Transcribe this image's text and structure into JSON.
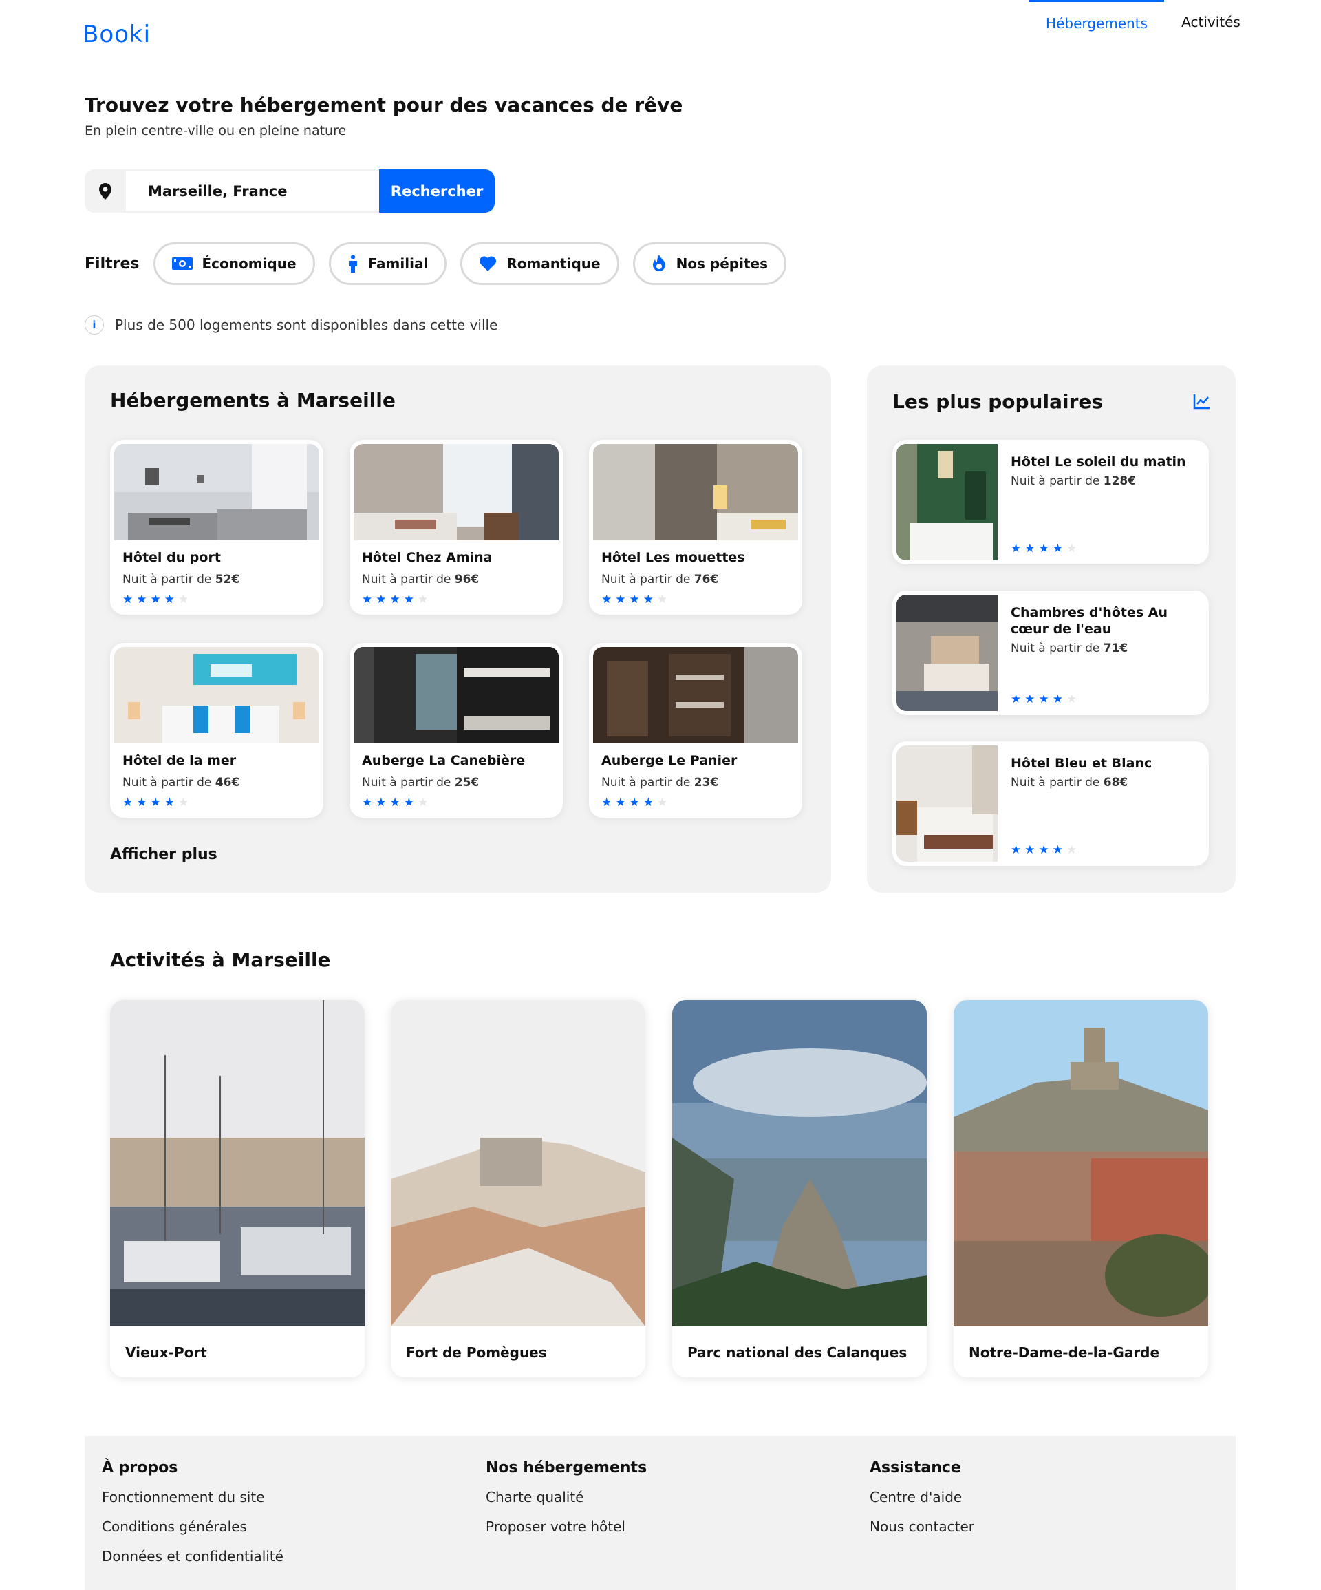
{
  "header": {
    "logo": "Booki",
    "nav": [
      {
        "label": "Hébergements",
        "active": true
      },
      {
        "label": "Activités",
        "active": false
      }
    ]
  },
  "hero": {
    "title": "Trouvez votre hébergement pour des vacances de rêve",
    "subtitle": "En plein centre-ville ou en pleine nature"
  },
  "search": {
    "value": "Marseille, France",
    "button": "Rechercher",
    "icon": "location-pin-icon"
  },
  "filters": {
    "label": "Filtres",
    "items": [
      {
        "label": "Économique",
        "icon": "money-icon"
      },
      {
        "label": "Familial",
        "icon": "person-icon"
      },
      {
        "label": "Romantique",
        "icon": "heart-icon"
      },
      {
        "label": "Nos pépites",
        "icon": "fire-icon"
      }
    ]
  },
  "info": {
    "text": "Plus de 500 logements sont disponibles dans cette ville"
  },
  "accommodations": {
    "title": "Hébergements à Marseille",
    "price_prefix": "Nuit à partir de ",
    "items": [
      {
        "name": "Hôtel du port",
        "price": "52€",
        "rating": 4
      },
      {
        "name": "Hôtel Chez Amina",
        "price": "96€",
        "rating": 4
      },
      {
        "name": "Hôtel Les mouettes",
        "price": "76€",
        "rating": 4
      },
      {
        "name": "Hôtel de la mer",
        "price": "46€",
        "rating": 4
      },
      {
        "name": "Auberge La Canebière",
        "price": "25€",
        "rating": 4
      },
      {
        "name": "Auberge Le Panier",
        "price": "23€",
        "rating": 4
      }
    ],
    "show_more": "Afficher plus"
  },
  "popular": {
    "title": "Les plus populaires",
    "icon": "trend-chart-icon",
    "price_prefix": "Nuit à partir de ",
    "items": [
      {
        "name": "Hôtel Le soleil du matin",
        "price": "128€",
        "rating": 4
      },
      {
        "name": "Chambres d'hôtes Au cœur de l'eau",
        "price": "71€",
        "rating": 4
      },
      {
        "name": "Hôtel Bleu et Blanc",
        "price": "68€",
        "rating": 4
      }
    ]
  },
  "activities": {
    "title": "Activités à Marseille",
    "items": [
      {
        "name": "Vieux-Port"
      },
      {
        "name": "Fort de Pomègues"
      },
      {
        "name": "Parc national des Calanques"
      },
      {
        "name": "Notre-Dame-de-la-Garde"
      }
    ]
  },
  "footer": {
    "columns": [
      {
        "title": "À propos",
        "links": [
          "Fonctionnement du site",
          "Conditions générales",
          "Données et confidentialité"
        ]
      },
      {
        "title": "Nos hébergements",
        "links": [
          "Charte qualité",
          "Proposer votre hôtel"
        ]
      },
      {
        "title": "Assistance",
        "links": [
          "Centre d'aide",
          "Nous contacter"
        ]
      }
    ]
  },
  "colors": {
    "accent": "#0065FC",
    "panel_bg": "#F2F2F2",
    "star_off": "#E6E6E6"
  }
}
